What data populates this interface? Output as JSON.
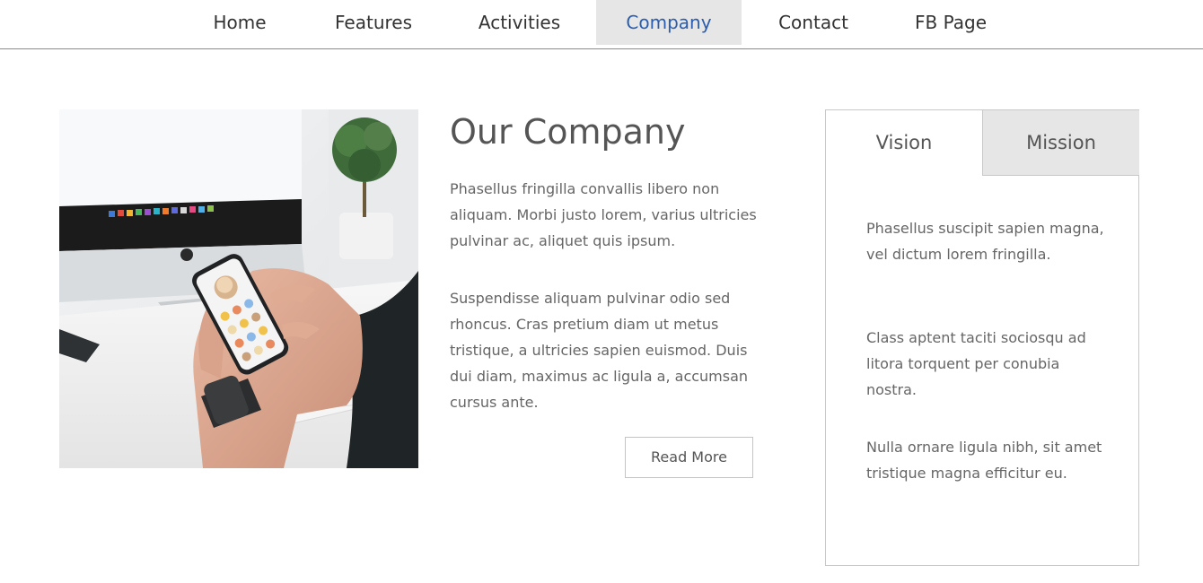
{
  "nav": {
    "items": [
      {
        "label": "Home"
      },
      {
        "label": "Features"
      },
      {
        "label": "Activities"
      },
      {
        "label": "Company",
        "active": true
      },
      {
        "label": "Contact"
      },
      {
        "label": "FB Page"
      }
    ]
  },
  "company": {
    "title": "Our Company",
    "paragraphs": [
      "Phasellus fringilla convallis libero non aliquam. Morbi justo lorem, varius ultricies pulvinar ac, aliquet quis ipsum.",
      "Suspendisse aliquam pulvinar odio sed rhoncus. Cras pretium diam ut metus tristique, a ultricies sapien euismod. Duis dui diam, maximus ac ligula a, accumsan cursus ante."
    ],
    "read_more_label": "Read More"
  },
  "tabs": {
    "items": [
      {
        "label": "Vision",
        "active": true
      },
      {
        "label": "Mission"
      }
    ],
    "vision_paragraphs": [
      "Phasellus suscipit sapien magna, vel dictum lorem fringilla.",
      "Class aptent taciti sociosqu ad litora torquent per conubia nostra.",
      "Nulla ornare ligula nibh, sit amet tristique magna efficitur eu."
    ]
  },
  "colors": {
    "active_nav_text": "#2a5db0",
    "active_nav_bg": "#e6e6e6",
    "inactive_tab_bg": "#e6e6e6"
  }
}
